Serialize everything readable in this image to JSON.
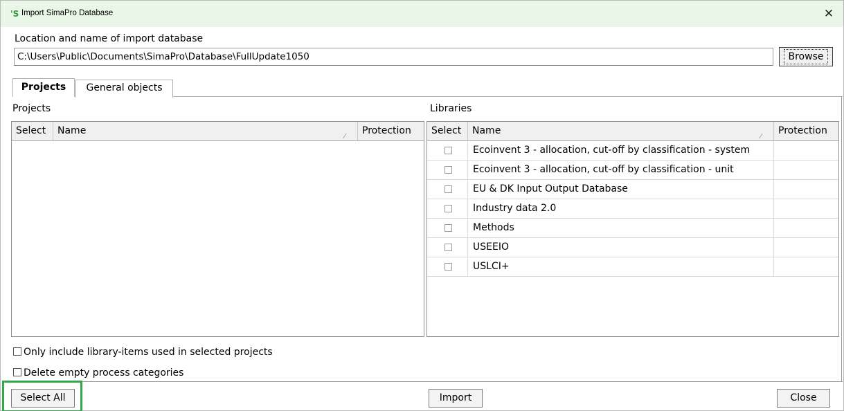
{
  "window": {
    "title": "Import SimaPro Database",
    "app_icon_glyph": "'S",
    "close_glyph": "✕"
  },
  "location": {
    "label": "Location and name of import database",
    "value": "C:\\Users\\Public\\Documents\\SimaPro\\Database\\FullUpdate1050",
    "browse_label": "Browse"
  },
  "tabs": [
    {
      "label": "Projects",
      "active": true
    },
    {
      "label": "General objects",
      "active": false
    }
  ],
  "projects": {
    "section_label": "Projects",
    "columns": [
      "Select",
      "Name",
      "Protection"
    ],
    "sort_glyph": "⁄",
    "rows": []
  },
  "libraries": {
    "section_label": "Libraries",
    "columns": [
      "Select",
      "Name",
      "Protection"
    ],
    "sort_glyph": "⁄",
    "rows": [
      {
        "name": "Ecoinvent 3 - allocation, cut-off by classification - system",
        "checked": false,
        "protection": ""
      },
      {
        "name": "Ecoinvent 3 - allocation, cut-off by classification - unit",
        "checked": false,
        "protection": ""
      },
      {
        "name": "EU & DK Input Output Database",
        "checked": false,
        "protection": ""
      },
      {
        "name": "Industry data 2.0",
        "checked": false,
        "protection": ""
      },
      {
        "name": "Methods",
        "checked": false,
        "protection": ""
      },
      {
        "name": "USEEIO",
        "checked": false,
        "protection": ""
      },
      {
        "name": "USLCI+",
        "checked": false,
        "protection": ""
      }
    ]
  },
  "options": {
    "only_include_label": "Only include library-items used in selected projects",
    "delete_empty_label": "Delete empty process categories"
  },
  "buttons": {
    "select_all": "Select All",
    "import": "Import",
    "close": "Close"
  },
  "colors": {
    "titlebar_bg": "#eaf6e8",
    "highlight": "#2ea84a",
    "header_bg": "#f0f0f0"
  }
}
